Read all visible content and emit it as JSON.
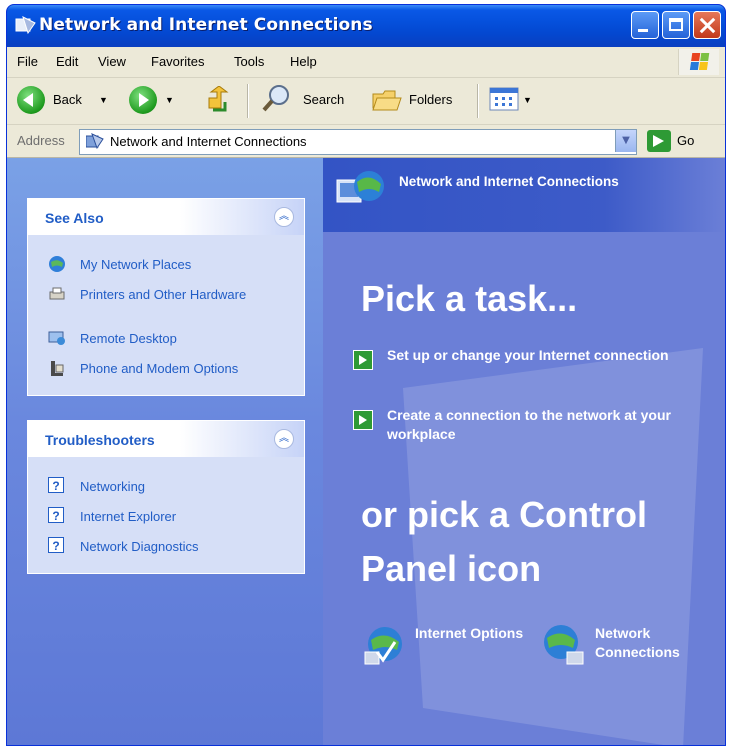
{
  "window": {
    "title": "Network and Internet Connections"
  },
  "menu": [
    "File",
    "Edit",
    "View",
    "Favorites",
    "Tools",
    "Help"
  ],
  "toolbar": {
    "back": "Back",
    "search": "Search",
    "folders": "Folders"
  },
  "address": {
    "label": "Address",
    "value": "Network and Internet Connections",
    "go": "Go"
  },
  "see_also": {
    "title": "See Also",
    "items": [
      "My Network Places",
      "Printers and Other Hardware",
      "Remote Desktop",
      "Phone and Modem Options"
    ]
  },
  "troubleshooters": {
    "title": "Troubleshooters",
    "items": [
      "Networking",
      "Internet Explorer",
      "Network Diagnostics"
    ]
  },
  "main": {
    "header": "Network and Internet Connections",
    "pick_task": "Pick a task...",
    "tasks": [
      "Set up or change your Internet connection",
      "Create a connection to the network at your workplace"
    ],
    "or_pick_line1": "or pick a Control",
    "or_pick_line2": "Panel icon",
    "icons": [
      "Internet Options",
      "Network Connections"
    ]
  },
  "colors": {
    "titlebar": "#0a58e6",
    "left_pane": "#6a88de",
    "right_pane": "#6b7fd7",
    "link": "#215dc6",
    "task_arrow": "#2e9a35"
  }
}
